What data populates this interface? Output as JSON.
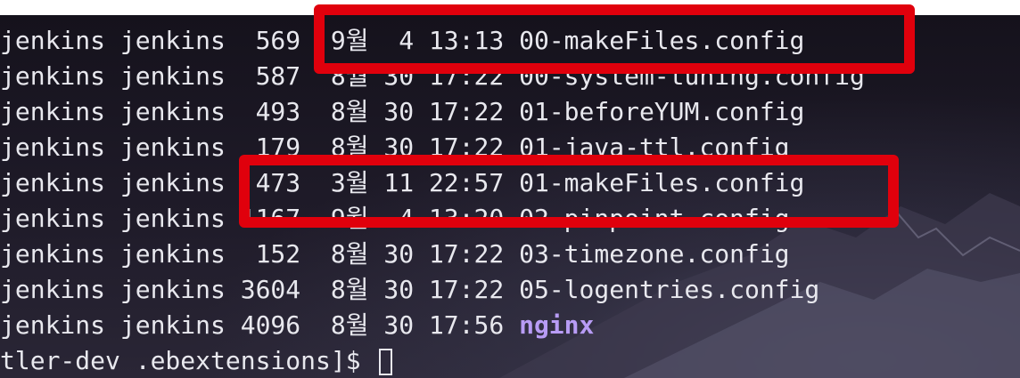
{
  "terminal": {
    "rows": [
      {
        "owner": "jenkins",
        "group": "jenkins",
        "size": "569",
        "month": "9월",
        "day": "4",
        "time": "13:13",
        "name": "00-makeFiles.config",
        "is_dir": false
      },
      {
        "owner": "jenkins",
        "group": "jenkins",
        "size": "587",
        "month": "8월",
        "day": "30",
        "time": "17:22",
        "name": "00-system-tuning.config",
        "is_dir": false
      },
      {
        "owner": "jenkins",
        "group": "jenkins",
        "size": "493",
        "month": "8월",
        "day": "30",
        "time": "17:22",
        "name": "01-beforeYUM.config",
        "is_dir": false
      },
      {
        "owner": "jenkins",
        "group": "jenkins",
        "size": "179",
        "month": "8월",
        "day": "30",
        "time": "17:22",
        "name": "01-java-ttl.config",
        "is_dir": false
      },
      {
        "owner": "jenkins",
        "group": "jenkins",
        "size": "473",
        "month": "3월",
        "day": "11",
        "time": "22:57",
        "name": "01-makeFiles.config",
        "is_dir": false
      },
      {
        "owner": "jenkins",
        "group": "jenkins",
        "size": "1167",
        "month": "9월",
        "day": "4",
        "time": "13:20",
        "name": "02-pinpoint.config",
        "is_dir": false
      },
      {
        "owner": "jenkins",
        "group": "jenkins",
        "size": "152",
        "month": "8월",
        "day": "30",
        "time": "17:22",
        "name": "03-timezone.config",
        "is_dir": false
      },
      {
        "owner": "jenkins",
        "group": "jenkins",
        "size": "3604",
        "month": "8월",
        "day": "30",
        "time": "17:22",
        "name": "05-logentries.config",
        "is_dir": false
      },
      {
        "owner": "jenkins",
        "group": "jenkins",
        "size": "4096",
        "month": "8월",
        "day": "30",
        "time": "17:56",
        "name": "nginx",
        "is_dir": true
      }
    ],
    "prompt": "tler-dev .ebextensions]$ "
  },
  "colors": {
    "text": "#e8e8ee",
    "directory": "#b89cf5",
    "highlight_box": "#e0000c",
    "background": "#1e1a26"
  }
}
